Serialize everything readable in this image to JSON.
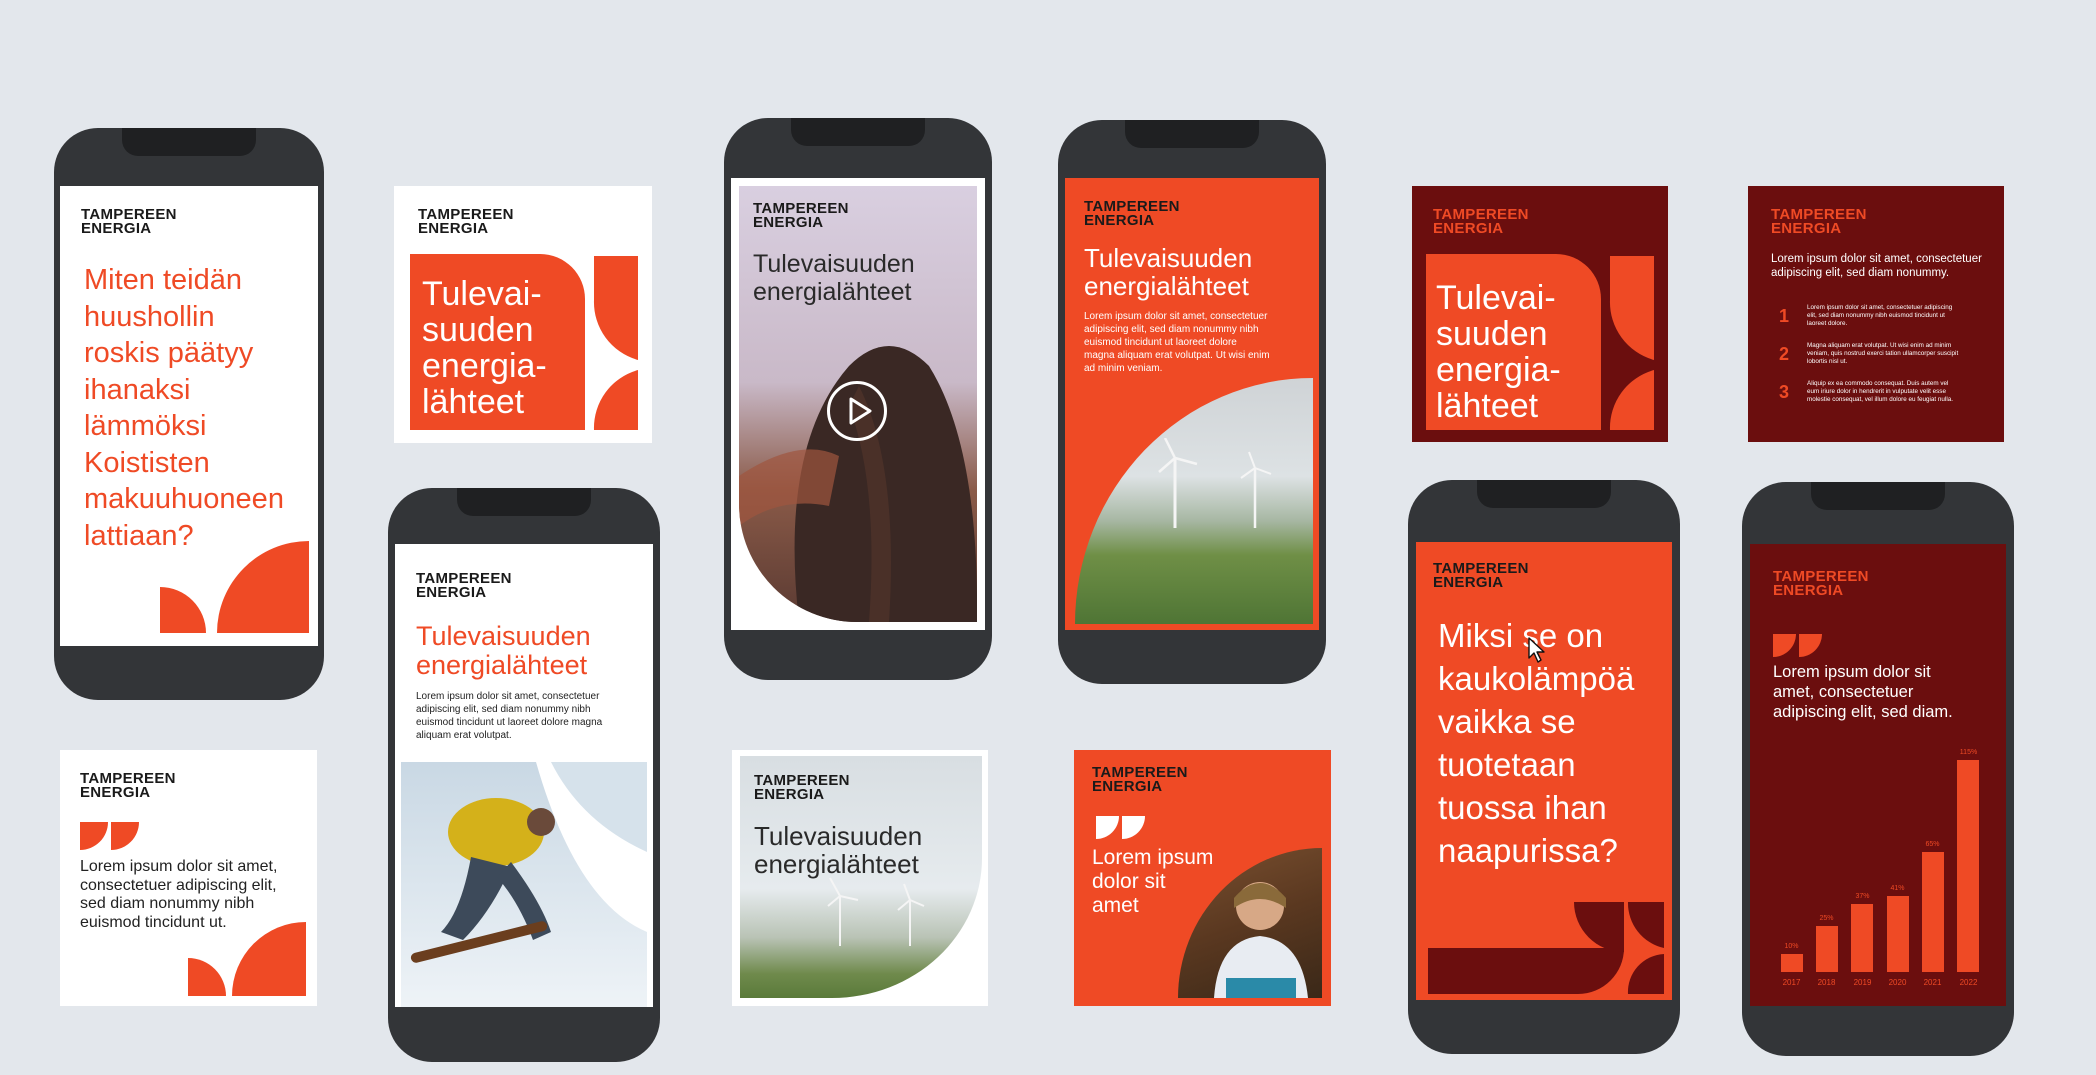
{
  "brand": {
    "name": "TAMPEREEN\nENERGIA",
    "orange": "#ef4a25",
    "maroon": "#6b0e0e",
    "background": "#e3e7ec"
  },
  "tiles": {
    "phone1": {
      "headline": "Miten teidän\nhuushollin\nroskis päätyy\nihanaksi\nlämmöksi\nKoististen\nmakuuhuoneen\nlattiaan?"
    },
    "square1": {
      "headline": "Tulevai-\nsuuden\nenergia-\nlähteet"
    },
    "quote1": {
      "text": "Lorem ipsum dolor sit amet,\nconsectetuer adipiscing elit,\nsed diam nonummy nibh\neuismod tincidunt ut."
    },
    "phone2": {
      "headline": "Tulevaisuuden\nenergialähteet",
      "body": "Lorem ipsum dolor sit amet, consectetuer\nadipiscing elit, sed diam nonummy nibh\neuismod tincidunt ut laoreet dolore magna\naliquam erat volutpat."
    },
    "video": {
      "headline": "Tulevaisuuden\nenergialähteet",
      "play_icon": "play-icon"
    },
    "square3": {
      "headline": "Tulevaisuuden\nenergialähteet"
    },
    "phone4": {
      "headline": "Tulevaisuuden\nenergialähteet",
      "body": "Lorem ipsum dolor sit amet, consectetuer\nadipiscing elit, sed diam nonummy nibh\neuismod tincidunt ut laoreet dolore\nmagna aliquam erat volutpat. Ut wisi enim\nad minim veniam."
    },
    "quote2": {
      "text": "Lorem ipsum\ndolor sit\namet"
    },
    "square5": {
      "headline": "Tulevai-\nsuuden\nenergia-\nlähteet"
    },
    "phone5": {
      "headline": "Miksi se on\nkaukolämpöä\nvaikka se\ntuotetaan\ntuossa ihan\nnaapurissa?"
    },
    "list": {
      "intro": "Lorem ipsum dolor sit amet, consectetuer\nadipiscing elit, sed diam nonummy.",
      "items": [
        {
          "num": "1",
          "text": "Lorem ipsum dolor sit amet, consectetuer adipiscing\nelit, sed diam nonummy nibh euismod tincidunt ut\nlaoreet dolore."
        },
        {
          "num": "2",
          "text": "Magna aliquam erat volutpat. Ut wisi enim ad minim\nveniam, quis nostrud exerci tation ullamcorper suscipit\nlobortis nisl ut."
        },
        {
          "num": "3",
          "text": "Aliquip ex ea commodo consequat. Duis autem vel\neum iriure dolor in hendrerit in vulputate velit esse\nmolestie consequat, vel illum dolore eu feugiat nulla."
        }
      ]
    },
    "phone6": {
      "quote": "Lorem ipsum dolor sit\namet, consectetuer\nadipiscing elit, sed diam."
    }
  },
  "chart_data": {
    "type": "bar",
    "categories": [
      "2017",
      "2018",
      "2019",
      "2020",
      "2021",
      "2022"
    ],
    "values": [
      10,
      25,
      37,
      41,
      65,
      115
    ],
    "value_labels": [
      "10%",
      "25%",
      "37%",
      "41%",
      "65%",
      "115%"
    ],
    "ylim": [
      0,
      115
    ],
    "grid": false,
    "color": "#ef4a25"
  }
}
